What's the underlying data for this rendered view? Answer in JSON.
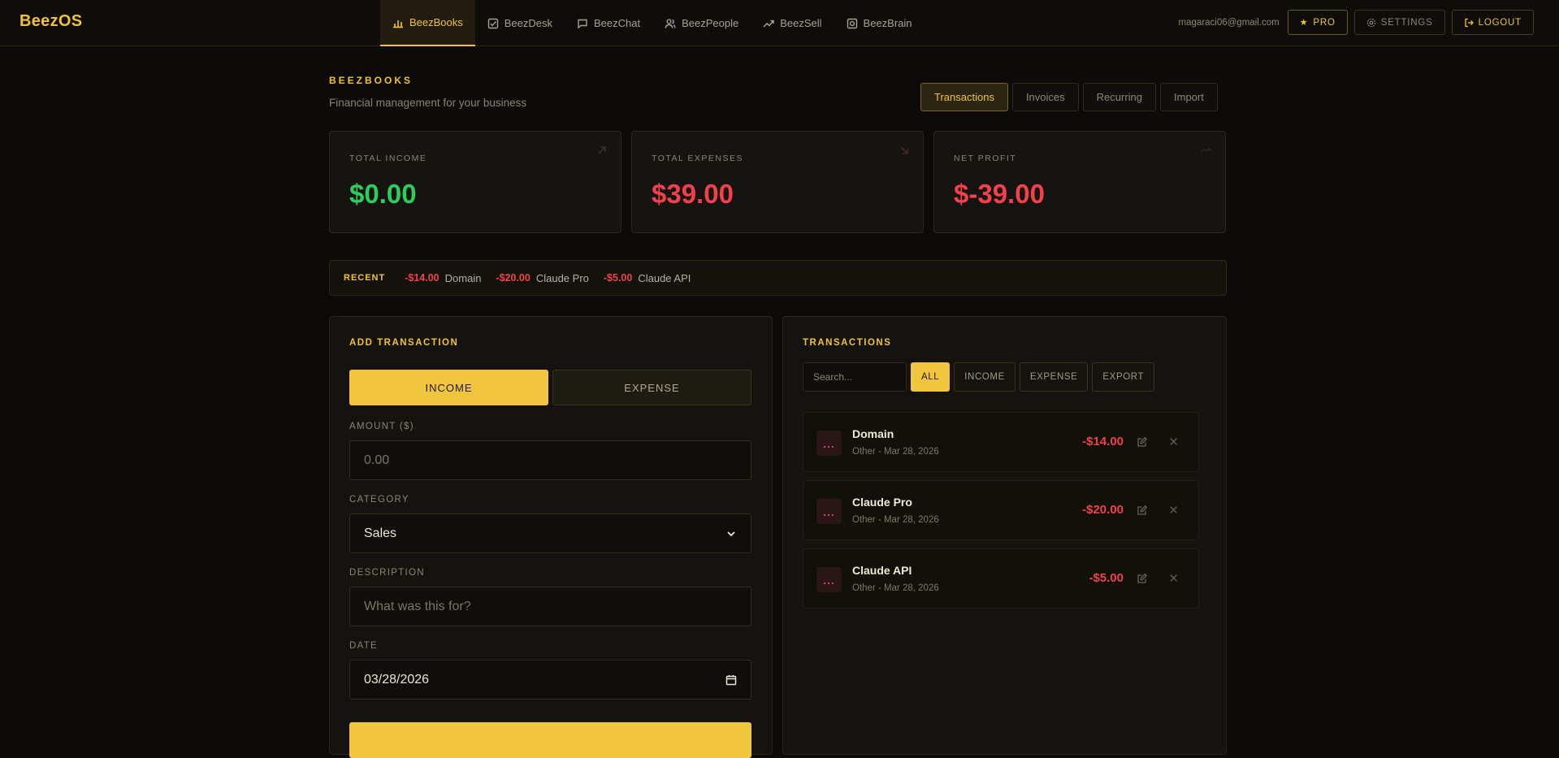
{
  "navbar": {
    "logo": "BeezOS",
    "apps": [
      {
        "label": "BeezBooks",
        "icon": "bar-chart-icon",
        "active": true
      },
      {
        "label": "BeezDesk",
        "icon": "check-square-icon"
      },
      {
        "label": "BeezChat",
        "icon": "chat-bubble-icon"
      },
      {
        "label": "BeezPeople",
        "icon": "users-icon"
      },
      {
        "label": "BeezSell",
        "icon": "trending-up-icon"
      },
      {
        "label": "BeezBrain",
        "icon": "brain-box-icon"
      }
    ],
    "email": "magaraci06@gmail.com",
    "pro_label": "PRO",
    "settings_label": "SETTINGS",
    "logout_label": "LOGOUT"
  },
  "header": {
    "title": "BEEZBOOKS",
    "subtitle": "Financial management for your business",
    "tabs": [
      "Transactions",
      "Invoices",
      "Recurring",
      "Import"
    ],
    "active_tab": "Transactions"
  },
  "stats": {
    "income": {
      "label": "TOTAL INCOME",
      "value": "$0.00"
    },
    "expenses": {
      "label": "TOTAL EXPENSES",
      "value": "$39.00"
    },
    "profit": {
      "label": "NET PROFIT",
      "value": "$-39.00"
    }
  },
  "recent": {
    "label": "RECENT",
    "items": [
      {
        "amount": "-$14.00",
        "name": "Domain"
      },
      {
        "amount": "-$20.00",
        "name": "Claude Pro"
      },
      {
        "amount": "-$5.00",
        "name": "Claude API"
      }
    ]
  },
  "add_transaction": {
    "title": "ADD TRANSACTION",
    "income_label": "INCOME",
    "expense_label": "EXPENSE",
    "selected_type": "INCOME",
    "amount_label": "AMOUNT ($)",
    "amount_placeholder": "0.00",
    "category_label": "CATEGORY",
    "category_value": "Sales",
    "description_label": "DESCRIPTION",
    "description_placeholder": "What was this for?",
    "date_label": "DATE",
    "date_value": "03/28/2026"
  },
  "transactions": {
    "title": "TRANSACTIONS",
    "search_placeholder": "Search...",
    "filters": [
      "ALL",
      "INCOME",
      "EXPENSE",
      "EXPORT"
    ],
    "active_filter": "ALL",
    "items": [
      {
        "icon": "...",
        "name": "Domain",
        "meta": "Other - Mar 28, 2026",
        "amount": "-$14.00"
      },
      {
        "icon": "...",
        "name": "Claude Pro",
        "meta": "Other - Mar 28, 2026",
        "amount": "-$20.00"
      },
      {
        "icon": "...",
        "name": "Claude API",
        "meta": "Other - Mar 28, 2026",
        "amount": "-$5.00"
      }
    ]
  },
  "colors": {
    "accent": "#f1c232",
    "income": "#2ecc5a",
    "expense": "#f2414b",
    "background": "#0c0b09"
  }
}
